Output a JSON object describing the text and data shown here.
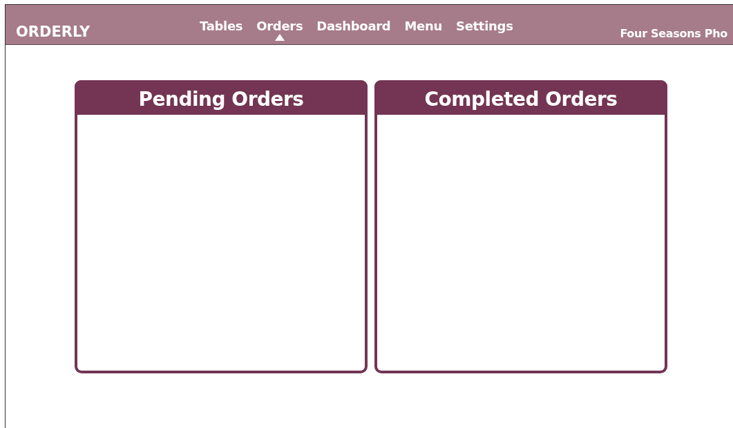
{
  "app": {
    "logo": "ORDERLY",
    "restaurant": "Four Seasons Pho"
  },
  "nav": [
    {
      "label": "Tables",
      "selected": false
    },
    {
      "label": "Orders",
      "selected": true
    },
    {
      "label": "Dashboard",
      "selected": false
    },
    {
      "label": "Menu",
      "selected": false
    },
    {
      "label": "Settings",
      "selected": false
    }
  ],
  "panels": [
    {
      "title": "Pending Orders"
    },
    {
      "title": "Completed Orders"
    }
  ]
}
